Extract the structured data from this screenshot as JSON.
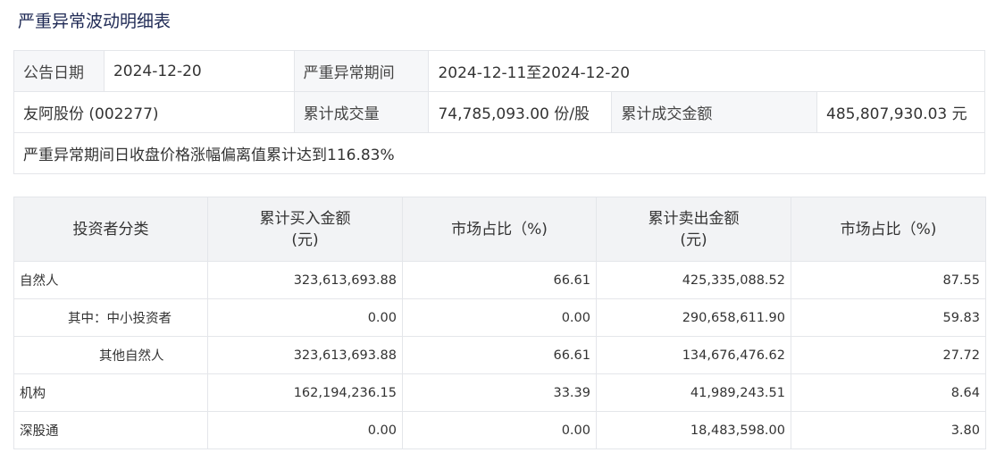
{
  "page_title": "严重异常波动明细表",
  "info": {
    "announce_date_label": "公告日期",
    "announce_date_value": "2024-12-20",
    "period_label": "严重异常期间",
    "period_value": "2024-12-11至2024-12-20",
    "stock_name": "友阿股份 (002277)",
    "volume_label": "累计成交量",
    "volume_value": "74,785,093.00 份/股",
    "amount_label": "累计成交金额",
    "amount_value": "485,807,930.03 元",
    "note": "严重异常期间日收盘价格涨幅偏离值累计达到116.83%"
  },
  "table": {
    "headers": {
      "category": "投资者分类",
      "buy_amount_line1": "累计买入金额",
      "buy_amount_line2": "(元)",
      "buy_share": "市场占比（%)",
      "sell_amount_line1": "累计卖出金额",
      "sell_amount_line2": "(元)",
      "sell_share": "市场占比（%)"
    },
    "rows": [
      {
        "category": "自然人",
        "buy": "323,613,693.88",
        "buy_pct": "66.61",
        "sell": "425,335,088.52",
        "sell_pct": "87.55"
      },
      {
        "category": "其中：中小投资者",
        "buy": "0.00",
        "buy_pct": "0.00",
        "sell": "290,658,611.90",
        "sell_pct": "59.83"
      },
      {
        "category": "其他自然人",
        "buy": "323,613,693.88",
        "buy_pct": "66.61",
        "sell": "134,676,476.62",
        "sell_pct": "27.72"
      },
      {
        "category": "机构",
        "buy": "162,194,236.15",
        "buy_pct": "33.39",
        "sell": "41,989,243.51",
        "sell_pct": "8.64"
      },
      {
        "category": "深股通",
        "buy": "0.00",
        "buy_pct": "0.00",
        "sell": "18,483,598.00",
        "sell_pct": "3.80"
      }
    ]
  }
}
